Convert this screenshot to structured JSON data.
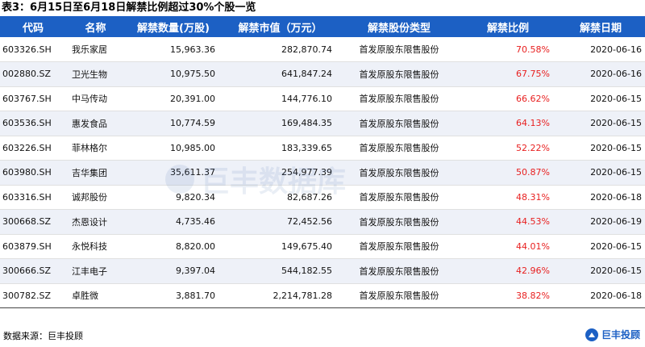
{
  "title": "表3：6月15日至6月18日解禁比例超过30%个股一览",
  "columns": [
    "代码",
    "名称",
    "解禁数量(万股)",
    "解禁市值（万元）",
    "解禁股份类型",
    "解禁比例",
    "解禁日期"
  ],
  "rows": [
    {
      "code": "603326.SH",
      "name": "我乐家居",
      "quantity": "15,963.36",
      "market_value": "282,870.74",
      "type": "首发原股东限售股份",
      "ratio": "70.58%",
      "date": "2020-06-16"
    },
    {
      "code": "002880.SZ",
      "name": "卫光生物",
      "quantity": "10,975.50",
      "market_value": "641,847.24",
      "type": "首发原股东限售股份",
      "ratio": "67.75%",
      "date": "2020-06-16"
    },
    {
      "code": "603767.SH",
      "name": "中马传动",
      "quantity": "20,391.00",
      "market_value": "144,776.10",
      "type": "首发原股东限售股份",
      "ratio": "66.62%",
      "date": "2020-06-15"
    },
    {
      "code": "603536.SH",
      "name": "惠发食品",
      "quantity": "10,774.59",
      "market_value": "169,484.35",
      "type": "首发原股东限售股份",
      "ratio": "64.13%",
      "date": "2020-06-15"
    },
    {
      "code": "603226.SH",
      "name": "菲林格尔",
      "quantity": "10,985.00",
      "market_value": "183,339.65",
      "type": "首发原股东限售股份",
      "ratio": "52.22%",
      "date": "2020-06-15"
    },
    {
      "code": "603980.SH",
      "name": "吉华集团",
      "quantity": "35,611.37",
      "market_value": "254,977.39",
      "type": "首发原股东限售股份",
      "ratio": "50.87%",
      "date": "2020-06-15"
    },
    {
      "code": "603316.SH",
      "name": "诚邦股份",
      "quantity": "9,820.34",
      "market_value": "82,687.26",
      "type": "首发原股东限售股份",
      "ratio": "48.31%",
      "date": "2020-06-18"
    },
    {
      "code": "300668.SZ",
      "name": "杰恩设计",
      "quantity": "4,735.46",
      "market_value": "72,452.56",
      "type": "首发原股东限售股份",
      "ratio": "44.53%",
      "date": "2020-06-19"
    },
    {
      "code": "603879.SH",
      "name": "永悦科技",
      "quantity": "8,820.00",
      "market_value": "149,675.40",
      "type": "首发原股东限售股份",
      "ratio": "44.01%",
      "date": "2020-06-15"
    },
    {
      "code": "300666.SZ",
      "name": "江丰电子",
      "quantity": "9,397.04",
      "market_value": "544,182.55",
      "type": "首发原股东限售股份",
      "ratio": "42.96%",
      "date": "2020-06-15"
    },
    {
      "code": "300782.SZ",
      "name": "卓胜微",
      "quantity": "3,881.70",
      "market_value": "2,214,781.28",
      "type": "首发原股东限售股份",
      "ratio": "38.82%",
      "date": "2020-06-18"
    }
  ],
  "watermark": "巨丰数据库",
  "source": "数据来源：巨丰投顾",
  "brand": "巨丰投顾",
  "colors": {
    "header_bg": "#1c60c4",
    "ratio_text": "#e81f1f",
    "stripe": "#eef1f8"
  }
}
